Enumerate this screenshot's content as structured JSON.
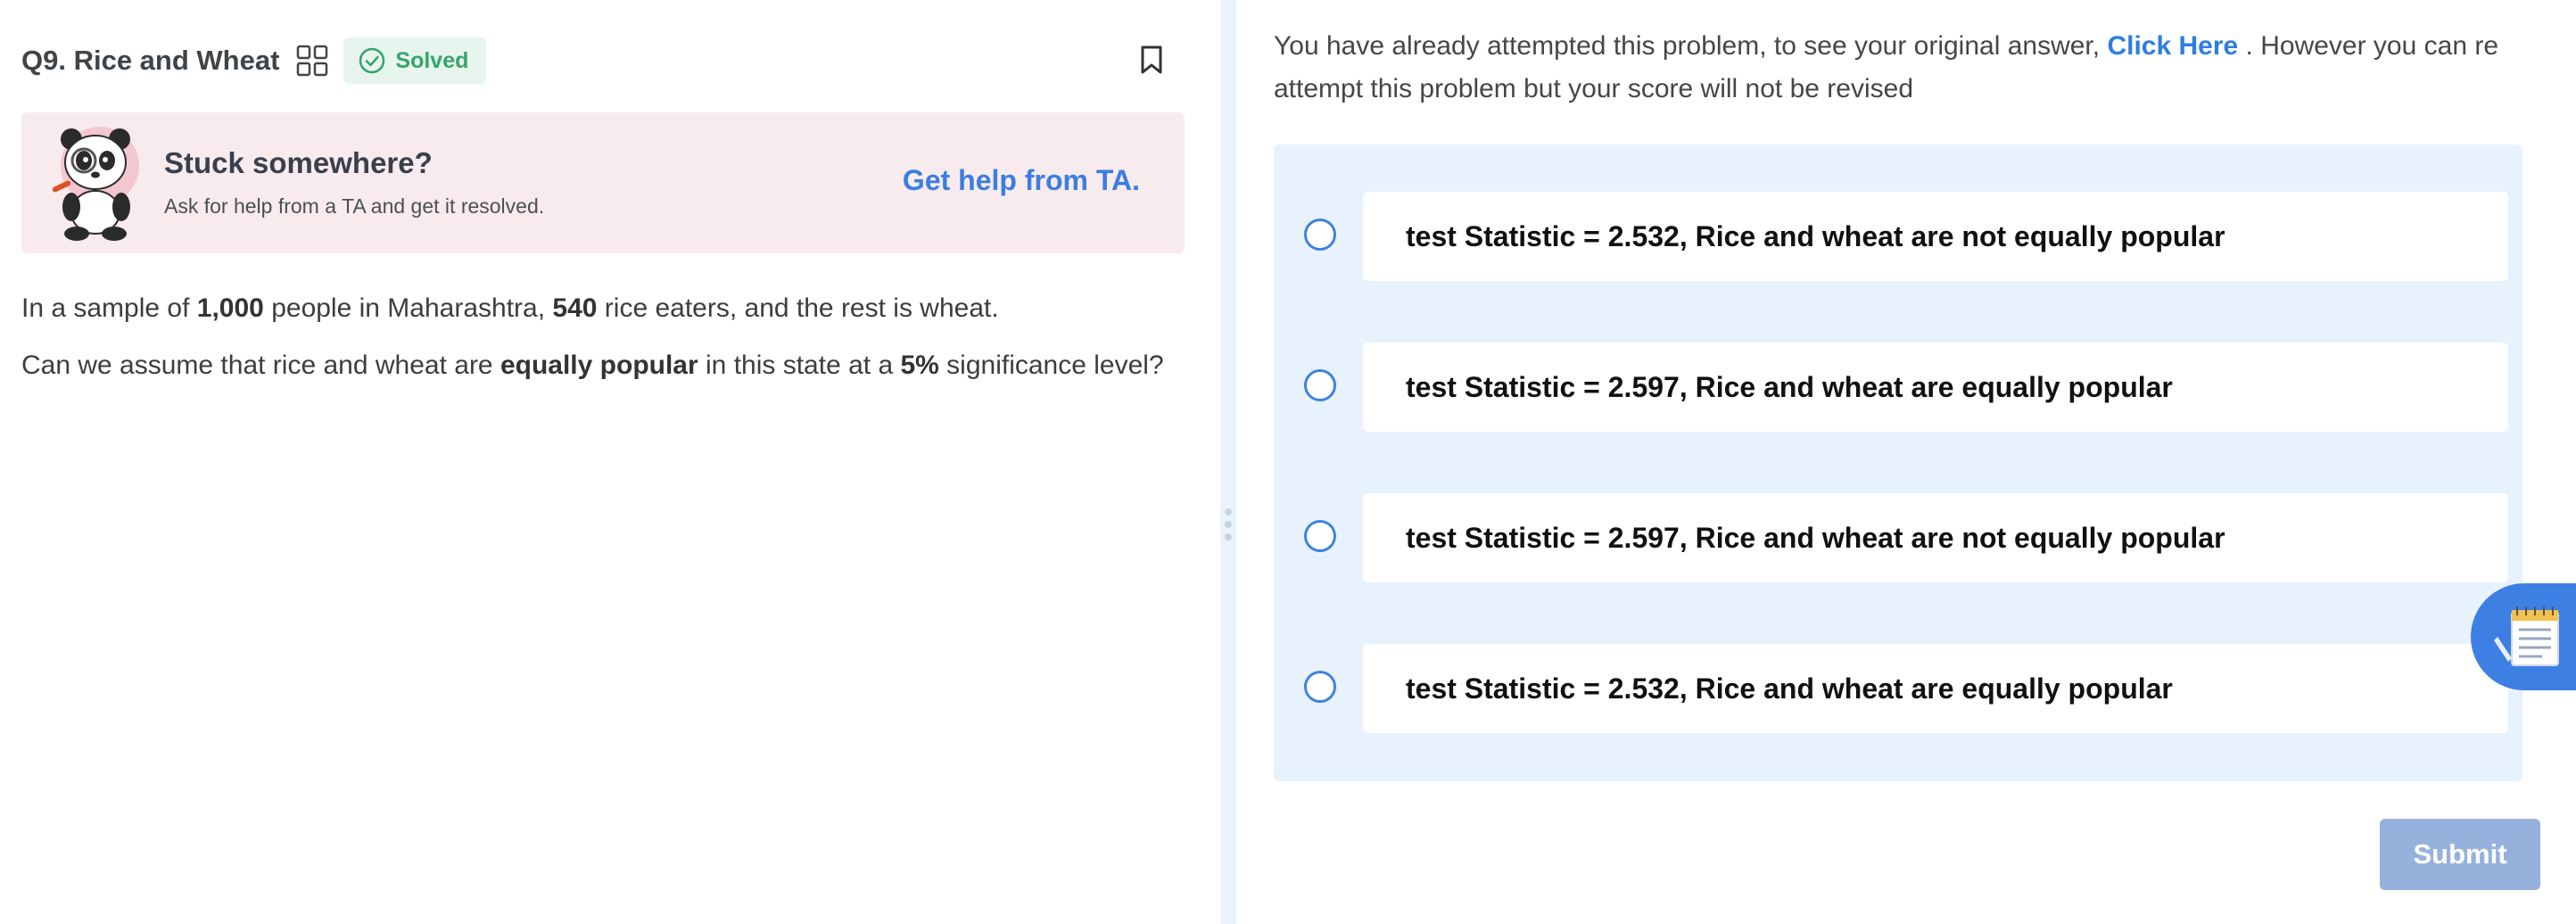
{
  "question": {
    "title": "Q9. Rice and Wheat",
    "status": "Solved"
  },
  "help": {
    "title": "Stuck somewhere?",
    "subtitle": "Ask for help from a TA and get it resolved.",
    "link": "Get help from TA."
  },
  "problem": {
    "line1": [
      {
        "text": "In a sample of ",
        "bold": false
      },
      {
        "text": "1,000",
        "bold": true
      },
      {
        "text": " people in Maharashtra, ",
        "bold": false
      },
      {
        "text": "540",
        "bold": true
      },
      {
        "text": " rice eaters, and the rest is wheat.",
        "bold": false
      }
    ],
    "line2": [
      {
        "text": "Can we assume that rice and wheat are ",
        "bold": false
      },
      {
        "text": "equally popular",
        "bold": true
      },
      {
        "text": " in this state at a ",
        "bold": false
      },
      {
        "text": "5%",
        "bold": true
      },
      {
        "text": " significance level?",
        "bold": false
      }
    ]
  },
  "notice": {
    "before": "You have already attempted this problem, to see your original answer,",
    "link": "Click Here",
    "after": ". However you can re attempt this problem but your score will not be revised"
  },
  "options": [
    {
      "label": "test Statistic = 2.532, Rice and wheat are not equally popular",
      "selected": false
    },
    {
      "label": "test Statistic = 2.597, Rice and wheat are equally popular",
      "selected": false
    },
    {
      "label": "test Statistic = 2.597, Rice and wheat are not equally popular",
      "selected": false
    },
    {
      "label": "test Statistic = 2.532, Rice and wheat are equally popular",
      "selected": false
    }
  ],
  "submit_label": "Submit",
  "colors": {
    "accent": "#3b7ee1",
    "solved": "#35a56a",
    "help_bg": "#f8ebee",
    "options_bg": "#e8f2fc",
    "submit_disabled": "#96b2dc"
  },
  "icons": {
    "grid": "grid-icon",
    "solved": "check-circle-icon",
    "bookmark": "bookmark-icon",
    "ta_mascot": "panda-mascot",
    "notes": "notepad-icon"
  }
}
